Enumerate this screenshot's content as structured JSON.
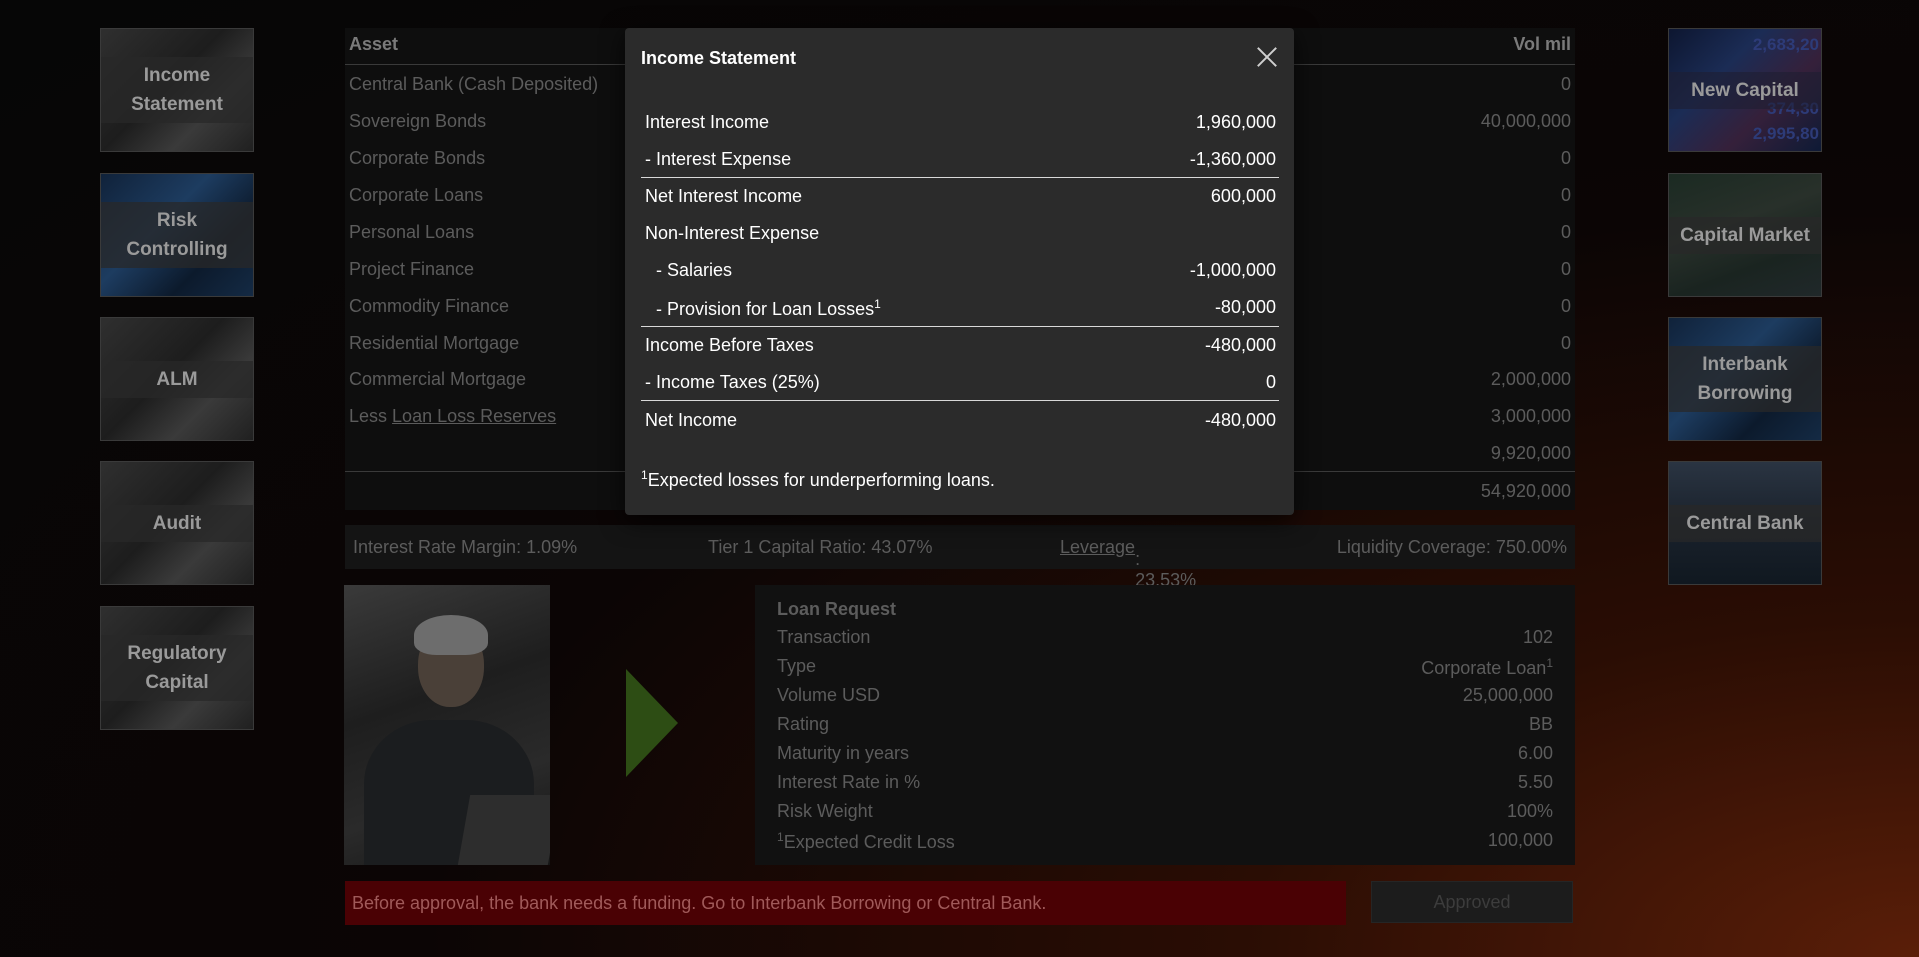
{
  "left_nav": [
    {
      "label_1": "Income",
      "label_2": "Statement"
    },
    {
      "label_1": "Risk",
      "label_2": "Controlling"
    },
    {
      "label_1": "ALM",
      "label_2": ""
    },
    {
      "label_1": "Audit",
      "label_2": ""
    },
    {
      "label_1": "Regulatory",
      "label_2": "Capital"
    }
  ],
  "right_nav": [
    {
      "label_1": "New Capital",
      "label_2": ""
    },
    {
      "label_1": "Capital Market",
      "label_2": ""
    },
    {
      "label_1": "Interbank",
      "label_2": "Borrowing"
    },
    {
      "label_1": "Central Bank",
      "label_2": ""
    }
  ],
  "new_capital_ticker": [
    "2,683,20",
    "374,30",
    "2,995,80"
  ],
  "assets": {
    "header_asset": "Asset",
    "header_vol": "Vol mil",
    "rows": [
      {
        "label": "Central Bank (Cash Deposited)",
        "value": "0"
      },
      {
        "label": "Sovereign Bonds",
        "value": "40,000,000"
      },
      {
        "label": "Corporate Bonds",
        "value": "0"
      },
      {
        "label": "Corporate Loans",
        "value": "0"
      },
      {
        "label": "Personal Loans",
        "value": "0"
      },
      {
        "label": "Project Finance",
        "value": "0"
      },
      {
        "label": "Commodity Finance",
        "value": "0"
      },
      {
        "label": "Residential Mortgage",
        "value": "0"
      },
      {
        "label": "Commercial Mortgage",
        "value": "2,000,000"
      }
    ],
    "less_prefix": "Less",
    "less_link": "Loan Loss Reserves",
    "less_value": "3,000,000",
    "subtotal": "9,920,000",
    "total": "54,920,000"
  },
  "ratios": {
    "interest_rate_margin": "Interest Rate Margin: 1.09%",
    "tier1": "Tier 1 Capital Ratio: 43.07%",
    "leverage_link": "Leverage",
    "leverage_value": ": 23.53%",
    "liquidity": "Liquidity Coverage: 750.00%"
  },
  "loan_request": {
    "title": "Loan Request",
    "rows": [
      {
        "label": "Transaction",
        "value": "102",
        "label_sup": "",
        "value_sup": ""
      },
      {
        "label": "Type",
        "value": "Corporate Loan",
        "label_sup": "",
        "value_sup": "1"
      },
      {
        "label": "Volume USD",
        "value": "25,000,000",
        "label_sup": "",
        "value_sup": ""
      },
      {
        "label": "Rating",
        "value": "BB",
        "label_sup": "",
        "value_sup": ""
      },
      {
        "label": "Maturity in years",
        "value": "6.00",
        "label_sup": "",
        "value_sup": ""
      },
      {
        "label": "Interest Rate in %",
        "value": "5.50",
        "label_sup": "",
        "value_sup": ""
      },
      {
        "label": "Risk Weight",
        "value": "100%",
        "label_sup": "",
        "value_sup": ""
      },
      {
        "label": "Expected Credit Loss",
        "value": "100,000",
        "label_sup": "1",
        "value_sup": ""
      }
    ]
  },
  "banner": "Before approval, the bank needs a funding. Go to Interbank Borrowing or Central Bank.",
  "approve_button": "Approved",
  "modal": {
    "title": "Income Statement",
    "rows": [
      {
        "label": "Interest Income",
        "value": "1,960,000",
        "sup": ""
      },
      {
        "label": "- Interest Expense",
        "value": "-1,360,000",
        "sup": ""
      },
      {
        "label": "Net Interest Income",
        "value": "600,000",
        "sup": ""
      },
      {
        "label": "Non-Interest Expense",
        "value": "",
        "sup": ""
      },
      {
        "label": "- Salaries",
        "value": "-1,000,000",
        "sup": ""
      },
      {
        "label": "- Provision for Loan Losses",
        "value": "-80,000",
        "sup": "1"
      },
      {
        "label": "Income Before Taxes",
        "value": "-480,000",
        "sup": ""
      },
      {
        "label": "- Income Taxes (25%)",
        "value": "0",
        "sup": ""
      },
      {
        "label": "Net Income",
        "value": "-480,000",
        "sup": ""
      }
    ],
    "footnote_sup": "1",
    "footnote": "Expected losses for underperforming loans."
  }
}
